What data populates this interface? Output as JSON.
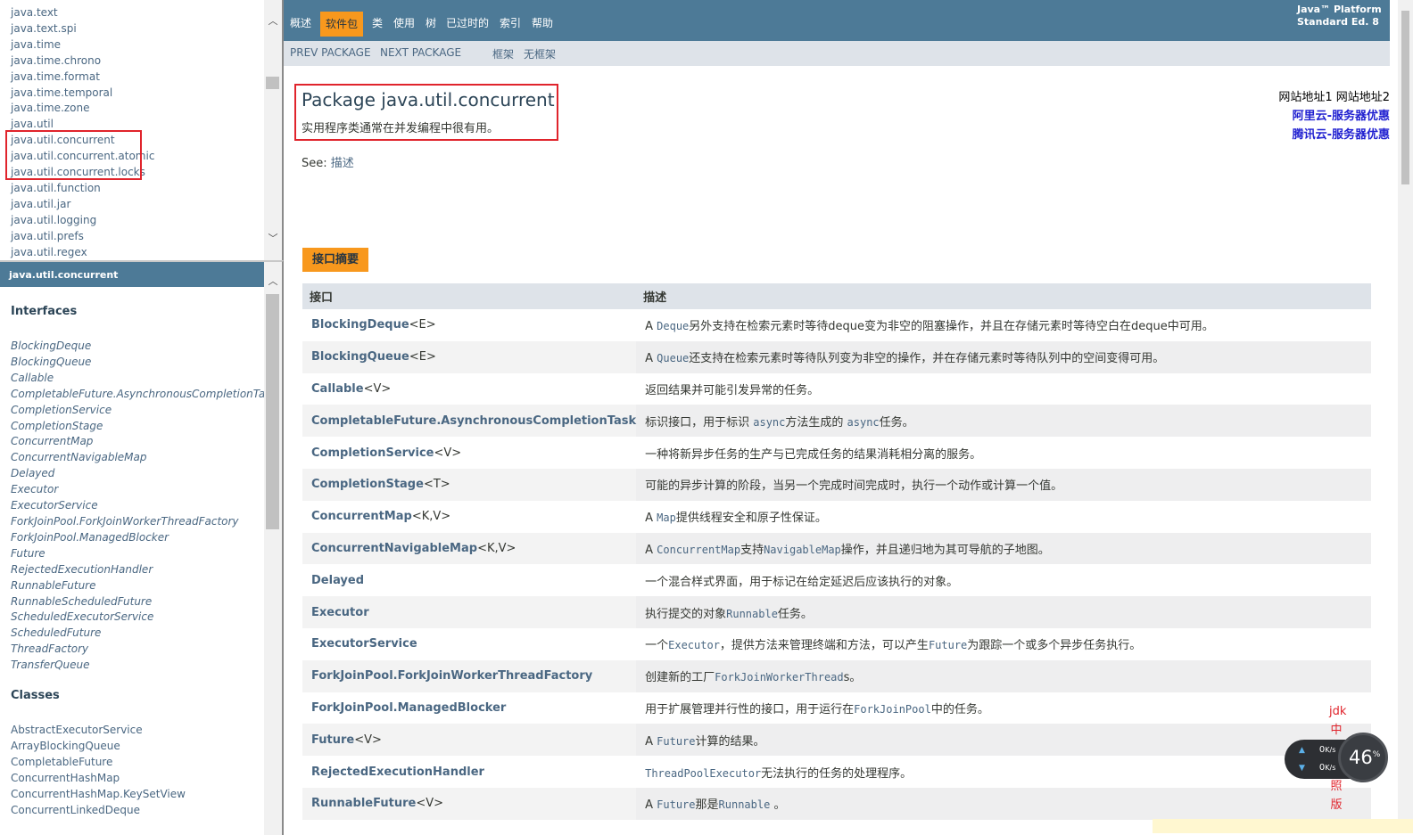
{
  "packages_frame": {
    "items": [
      "java.text",
      "java.text.spi",
      "java.time",
      "java.time.chrono",
      "java.time.format",
      "java.time.temporal",
      "java.time.zone",
      "java.util",
      "java.util.concurrent",
      "java.util.concurrent.atomic",
      "java.util.concurrent.locks",
      "java.util.function",
      "java.util.jar",
      "java.util.logging",
      "java.util.prefs",
      "java.util.regex"
    ]
  },
  "classes_frame": {
    "header": "java.util.concurrent",
    "interfaces_title": "Interfaces",
    "interfaces": [
      "BlockingDeque",
      "BlockingQueue",
      "Callable",
      "CompletableFuture.AsynchronousCompletionTask",
      "CompletionService",
      "CompletionStage",
      "ConcurrentMap",
      "ConcurrentNavigableMap",
      "Delayed",
      "Executor",
      "ExecutorService",
      "ForkJoinPool.ForkJoinWorkerThreadFactory",
      "ForkJoinPool.ManagedBlocker",
      "Future",
      "RejectedExecutionHandler",
      "RunnableFuture",
      "RunnableScheduledFuture",
      "ScheduledExecutorService",
      "ScheduledFuture",
      "ThreadFactory",
      "TransferQueue"
    ],
    "classes_title": "Classes",
    "classes": [
      "AbstractExecutorService",
      "ArrayBlockingQueue",
      "CompletableFuture",
      "ConcurrentHashMap",
      "ConcurrentHashMap.KeySetView",
      "ConcurrentLinkedDeque"
    ]
  },
  "topnav": {
    "items": [
      "概述",
      "软件包",
      "类",
      "使用",
      "树",
      "已过时的",
      "索引",
      "帮助"
    ],
    "active": "软件包",
    "platform_line1": "Java™ Platform",
    "platform_line2": "Standard Ed. 8"
  },
  "subnav": {
    "prev": "PREV PACKAGE",
    "next": "NEXT PACKAGE",
    "frames": "框架",
    "noframes": "无框架"
  },
  "header": {
    "title": "Package java.util.concurrent",
    "description": "实用程序类通常在并发编程中很有用。",
    "see_label": "See:",
    "see_link": "描述"
  },
  "ads": {
    "title": "网站地址1 网站地址2",
    "link1": "阿里云-服务器优惠",
    "link2": "腾讯云-服务器优惠"
  },
  "summary": {
    "tab_label": "接口摘要",
    "col_interface": "接口",
    "col_desc": "描述",
    "rows": [
      {
        "name": "BlockingDeque",
        "tp": "<E>",
        "desc": [
          [
            "t",
            "A "
          ],
          [
            "c",
            "Deque"
          ],
          [
            "t",
            "另外支持在检索元素时等待deque变为非空的阻塞操作，并且在存储元素时等待空白在deque中可用。"
          ]
        ]
      },
      {
        "name": "BlockingQueue",
        "tp": "<E>",
        "desc": [
          [
            "t",
            "A "
          ],
          [
            "c",
            "Queue"
          ],
          [
            "t",
            "还支持在检索元素时等待队列变为非空的操作，并在存储元素时等待队列中的空间变得可用。"
          ]
        ]
      },
      {
        "name": "Callable",
        "tp": "<V>",
        "desc": [
          [
            "t",
            "返回结果并可能引发异常的任务。"
          ]
        ]
      },
      {
        "name": "CompletableFuture.AsynchronousCompletionTask",
        "tp": "",
        "desc": [
          [
            "t",
            "标识接口，用于标识 "
          ],
          [
            "c",
            "async"
          ],
          [
            "t",
            "方法生成的 "
          ],
          [
            "c",
            "async"
          ],
          [
            "t",
            "任务。"
          ]
        ]
      },
      {
        "name": "CompletionService",
        "tp": "<V>",
        "desc": [
          [
            "t",
            "一种将新异步任务的生产与已完成任务的结果消耗相分离的服务。"
          ]
        ]
      },
      {
        "name": "CompletionStage",
        "tp": "<T>",
        "desc": [
          [
            "t",
            "可能的异步计算的阶段，当另一个完成时间完成时，执行一个动作或计算一个值。"
          ]
        ]
      },
      {
        "name": "ConcurrentMap",
        "tp": "<K,V>",
        "desc": [
          [
            "t",
            "A "
          ],
          [
            "c",
            "Map"
          ],
          [
            "t",
            "提供线程安全和原子性保证。"
          ]
        ]
      },
      {
        "name": "ConcurrentNavigableMap",
        "tp": "<K,V>",
        "desc": [
          [
            "t",
            "A "
          ],
          [
            "c",
            "ConcurrentMap"
          ],
          [
            "t",
            "支持"
          ],
          [
            "c",
            "NavigableMap"
          ],
          [
            "t",
            "操作，并且递归地为其可导航的子地图。"
          ]
        ]
      },
      {
        "name": "Delayed",
        "tp": "",
        "desc": [
          [
            "t",
            "一个混合样式界面，用于标记在给定延迟后应该执行的对象。"
          ]
        ]
      },
      {
        "name": "Executor",
        "tp": "",
        "desc": [
          [
            "t",
            "执行提交的对象"
          ],
          [
            "c",
            "Runnable"
          ],
          [
            "t",
            "任务。"
          ]
        ]
      },
      {
        "name": "ExecutorService",
        "tp": "",
        "desc": [
          [
            "t",
            "一个"
          ],
          [
            "c",
            "Executor"
          ],
          [
            "t",
            "，提供方法来管理终端和方法，可以产生"
          ],
          [
            "c",
            "Future"
          ],
          [
            "t",
            "为跟踪一个或多个异步任务执行。"
          ]
        ]
      },
      {
        "name": "ForkJoinPool.ForkJoinWorkerThreadFactory",
        "tp": "",
        "desc": [
          [
            "t",
            "创建新的工厂"
          ],
          [
            "c",
            "ForkJoinWorkerThread"
          ],
          [
            "t",
            "s。"
          ]
        ]
      },
      {
        "name": "ForkJoinPool.ManagedBlocker",
        "tp": "",
        "desc": [
          [
            "t",
            "用于扩展管理并行性的接口，用于运行在"
          ],
          [
            "c",
            "ForkJoinPool"
          ],
          [
            "t",
            "中的任务。"
          ]
        ]
      },
      {
        "name": "Future",
        "tp": "<V>",
        "desc": [
          [
            "t",
            "A "
          ],
          [
            "c",
            "Future"
          ],
          [
            "t",
            "计算的结果。"
          ]
        ]
      },
      {
        "name": "RejectedExecutionHandler",
        "tp": "",
        "desc": [
          [
            "c",
            "ThreadPoolExecutor"
          ],
          [
            "t",
            "无法执行的任务的处理程序。"
          ]
        ]
      },
      {
        "name": "RunnableFuture",
        "tp": "<V>",
        "desc": [
          [
            "t",
            "A "
          ],
          [
            "c",
            "Future"
          ],
          [
            "t",
            "那是"
          ],
          [
            "c",
            "Runnable"
          ],
          [
            "t",
            " 。"
          ]
        ]
      }
    ]
  },
  "overlay": {
    "jdk_note": [
      "jdk",
      "中",
      "",
      "",
      "照",
      "版"
    ],
    "up_speed": "0",
    "down_speed": "0",
    "speed_unit": "K/s",
    "gauge_value": "46",
    "gauge_unit": "%"
  }
}
